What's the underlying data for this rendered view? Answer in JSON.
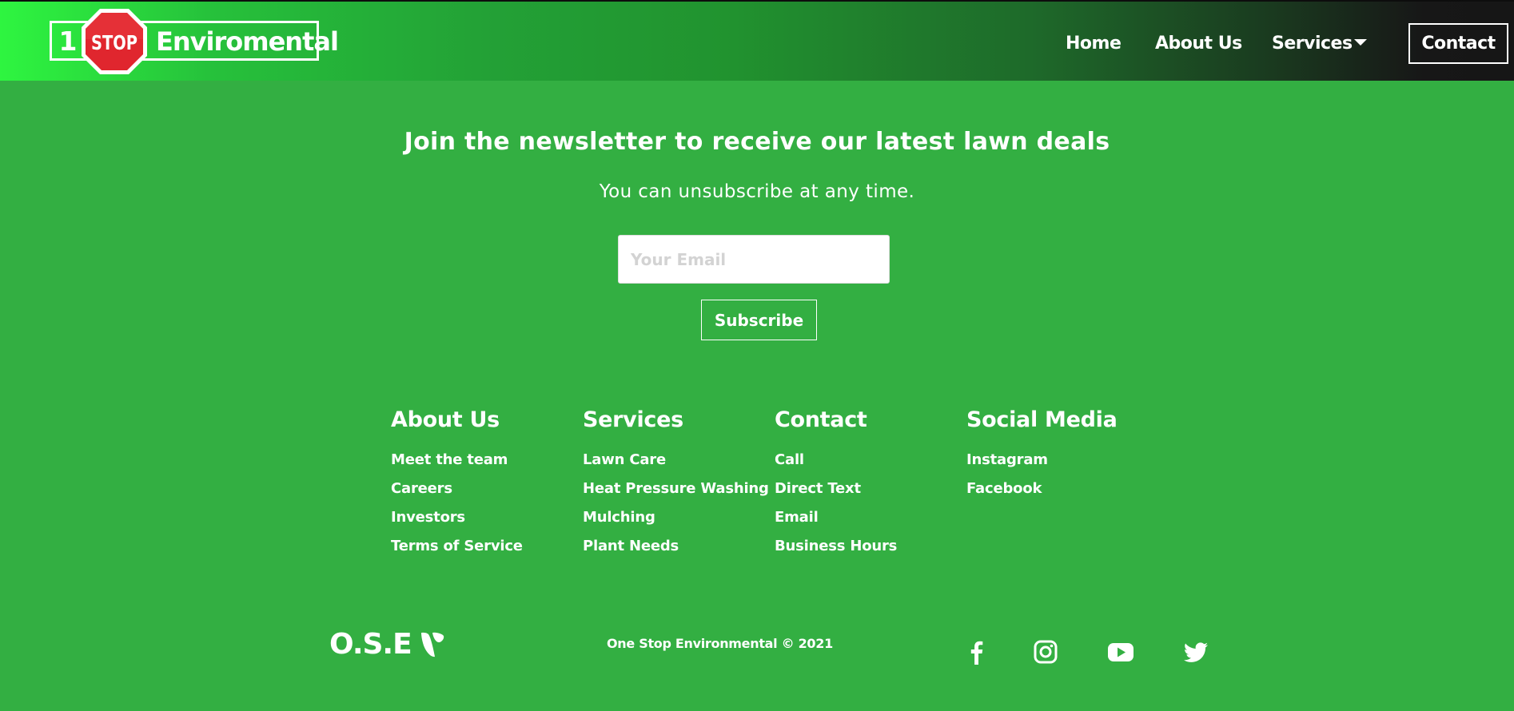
{
  "header": {
    "logo": {
      "number": "1",
      "sign_text": "STOP",
      "name": "Enviromental"
    },
    "nav": [
      {
        "label": "Home"
      },
      {
        "label": "About Us"
      },
      {
        "label": "Services",
        "has_dropdown": true
      }
    ],
    "contact_label": "Contact",
    "colors": {
      "stop_sign": "#e0262e",
      "gradient_start": "#2ef540",
      "gradient_end": "#161616"
    }
  },
  "newsletter": {
    "title": "Join the newsletter to receive our latest lawn deals",
    "subtitle": "You can unsubscribe at any time.",
    "email_value": "",
    "email_placeholder": "Your Email",
    "subscribe_label": "Subscribe"
  },
  "footer": {
    "columns": [
      {
        "title": "About Us",
        "links": [
          "Meet the team",
          "Careers",
          "Investors",
          "Terms of Service"
        ]
      },
      {
        "title": "Services",
        "links": [
          "Lawn Care",
          "Heat Pressure Washing",
          "Mulching",
          "Plant Needs"
        ]
      },
      {
        "title": "Contact",
        "links": [
          "Call",
          "Direct Text",
          "Email",
          "Business Hours"
        ]
      },
      {
        "title": "Social Media",
        "links": [
          "Instagram",
          "Facebook"
        ]
      }
    ],
    "brand": {
      "text": "O.S.E",
      "icon": "typo3-icon"
    },
    "copyright": "One Stop Environmental © 2021",
    "social_icons": [
      "facebook-icon",
      "instagram-icon",
      "youtube-icon",
      "twitter-icon"
    ],
    "background": "#33af42"
  }
}
